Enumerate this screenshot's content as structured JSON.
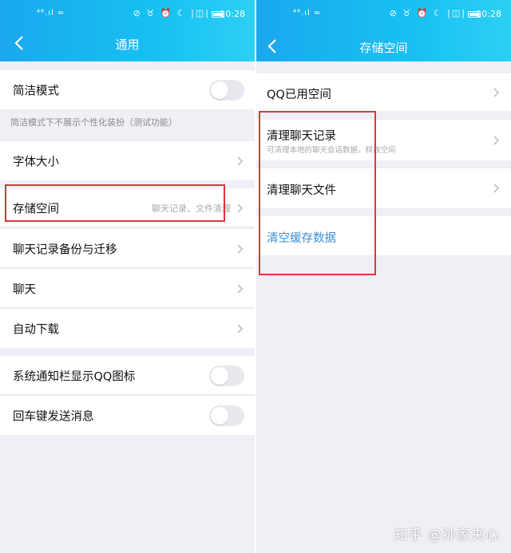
{
  "status_bar": {
    "signal": "⁴⁶.ıl ≈",
    "icons": "⊘ ♉ ⏰ ☾ |◫|",
    "time": "10:28"
  },
  "left_screen": {
    "title": "通用",
    "rows": [
      {
        "label": "简洁模式",
        "toggle": false
      },
      {
        "label": "字体大小"
      },
      {
        "label": "存储空间",
        "hint": "聊天记录、文件清理"
      },
      {
        "label": "聊天记录备份与迁移"
      },
      {
        "label": "聊天"
      },
      {
        "label": "自动下载"
      },
      {
        "label": "系统通知栏显示QQ图标",
        "toggle": false
      },
      {
        "label": "回车键发送消息",
        "toggle": false
      }
    ],
    "note": "简洁模式下不展示个性化装扮（测试功能）"
  },
  "right_screen": {
    "title": "存储空间",
    "qq_used_space": "QQ已用空间",
    "clear_chat_records": "清理聊天记录",
    "clear_chat_records_sub": "可清理本地的聊天会话数据，释放空间",
    "clear_chat_files": "清理聊天文件",
    "clear_cache": "清空缓存数据"
  },
  "watermark": "知乎 @孙家夹心",
  "colors": {
    "header_gradient_start": "#1aa8ee",
    "header_gradient_end": "#2cd0f4",
    "highlight_red": "#e0343a",
    "link_blue": "#3d8fd8"
  }
}
